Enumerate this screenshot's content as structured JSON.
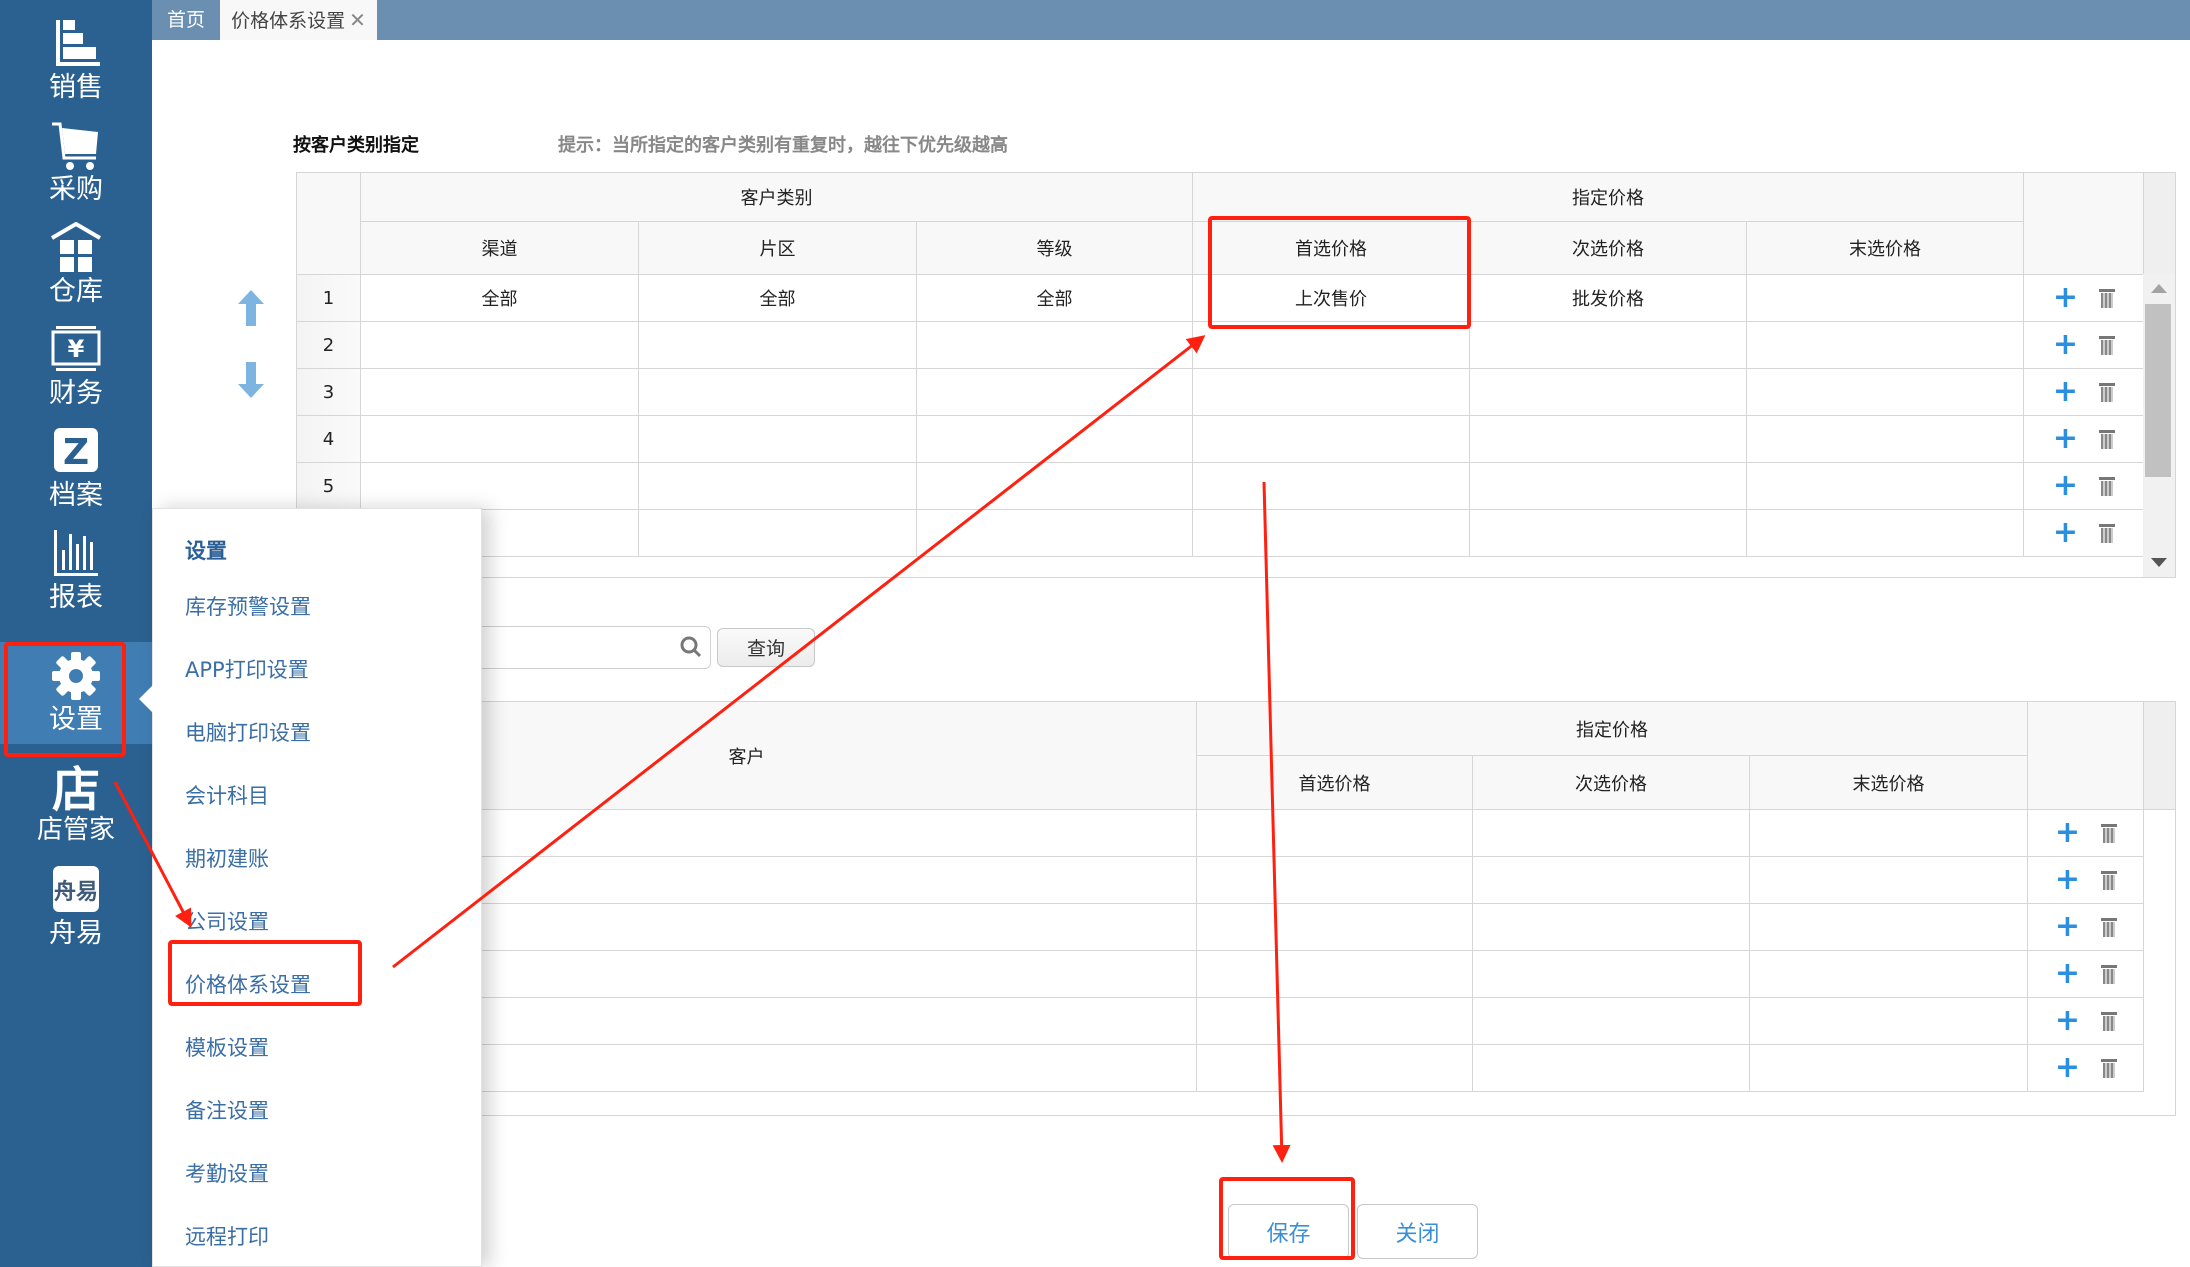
{
  "sidebar": {
    "items": [
      {
        "label": "销售",
        "icon": "sales-chart-icon"
      },
      {
        "label": "采购",
        "icon": "cart-icon"
      },
      {
        "label": "仓库",
        "icon": "warehouse-icon"
      },
      {
        "label": "财务",
        "icon": "finance-yen-icon"
      },
      {
        "label": "档案",
        "icon": "archive-z-icon"
      },
      {
        "label": "报表",
        "icon": "bar-chart-icon"
      },
      {
        "label": "设置",
        "icon": "gear-icon",
        "active": true
      },
      {
        "label": "店管家",
        "icon": "store-icon"
      },
      {
        "label": "舟易",
        "icon": "zhouyi-logo-icon"
      }
    ]
  },
  "tabs": {
    "home": "首页",
    "active": "价格体系设置",
    "close_glyph": "✕"
  },
  "section": {
    "title": "按客户类别指定",
    "hint": "提示：当所指定的客户类别有重复时，越往下优先级越高"
  },
  "table1": {
    "group_headers": {
      "customer_category": "客户类别",
      "specified_price": "指定价格"
    },
    "columns": [
      "渠道",
      "片区",
      "等级",
      "首选价格",
      "次选价格",
      "末选价格"
    ],
    "rows": [
      {
        "num": "1",
        "cells": [
          "全部",
          "全部",
          "全部",
          "上次售价",
          "批发价格",
          ""
        ]
      },
      {
        "num": "2",
        "cells": [
          "",
          "",
          "",
          "",
          "",
          ""
        ]
      },
      {
        "num": "3",
        "cells": [
          "",
          "",
          "",
          "",
          "",
          ""
        ]
      },
      {
        "num": "4",
        "cells": [
          "",
          "",
          "",
          "",
          "",
          ""
        ]
      },
      {
        "num": "5",
        "cells": [
          "",
          "",
          "",
          "",
          "",
          ""
        ]
      },
      {
        "num": "",
        "cells": [
          "",
          "",
          "",
          "",
          "",
          ""
        ]
      }
    ],
    "add_glyph": "+"
  },
  "search": {
    "placeholder": "",
    "value": "",
    "query_label": "查询"
  },
  "table2": {
    "customer_header": "客户",
    "group_header": "指定价格",
    "columns": [
      "首选价格",
      "次选价格",
      "末选价格"
    ],
    "row_count": 6,
    "add_glyph": "+"
  },
  "footer": {
    "save_label": "保存",
    "close_label": "关闭"
  },
  "popup_menu": {
    "heading": "设置",
    "items": [
      "库存预警设置",
      "APP打印设置",
      "电脑打印设置",
      "会计科目",
      "期初建账",
      "公司设置",
      "价格体系设置",
      "模板设置",
      "备注设置",
      "考勤设置",
      "远程打印"
    ],
    "highlighted": "价格体系设置"
  },
  "colors": {
    "sidebar_bg": "#2b6190",
    "sidebar_active": "#3f7db3",
    "tabbar_bg": "#6a8fb0",
    "link_blue": "#3a6ea5",
    "add_blue": "#2a8fe0",
    "annotation_red": "#ff2010"
  }
}
